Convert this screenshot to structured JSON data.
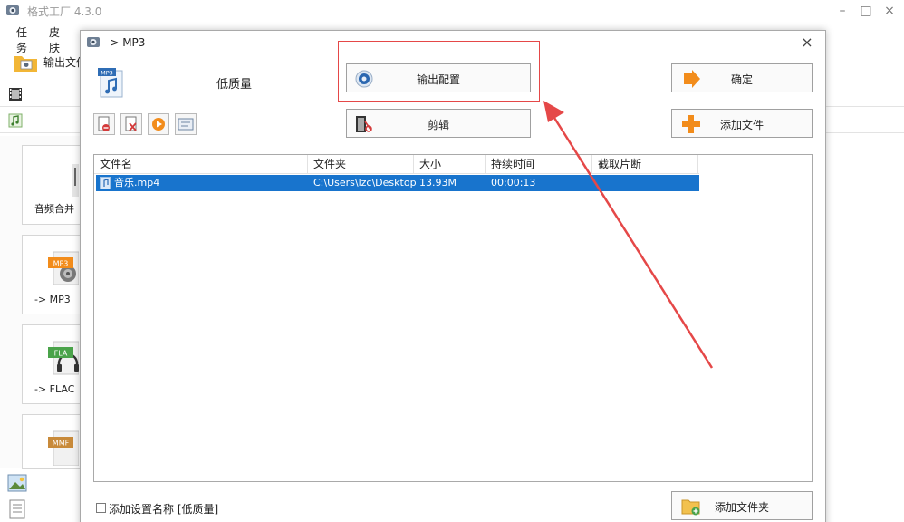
{
  "main_window": {
    "title": "格式工厂 4.3.0",
    "menu": [
      "任务",
      "皮肤"
    ],
    "toolbar": {
      "output_folder_label": "输出文件"
    },
    "tiles": [
      {
        "label": "音频合并"
      },
      {
        "label": "-> MP3",
        "badge": "MP3"
      },
      {
        "label": "-> FLAC",
        "badge": "FLA"
      },
      {
        "badge": "MMF"
      }
    ],
    "controls": {
      "minimize": "–",
      "maximize": "□",
      "close": "×"
    }
  },
  "dialog": {
    "title": "-> MP3",
    "close": "×",
    "profile_badge": "MP3",
    "quality": "低质量",
    "buttons": {
      "output_config": "输出配置",
      "ok": "确定",
      "clip": "剪辑",
      "add_file": "添加文件",
      "add_folder": "添加文件夹"
    },
    "table": {
      "columns": [
        "文件名",
        "文件夹",
        "大小",
        "持续时间",
        "截取片断"
      ],
      "rows": [
        {
          "name": "音乐.mp4",
          "folder": "C:\\Users\\lzc\\Desktop",
          "size": "13.93M",
          "duration": "00:00:13",
          "clip": ""
        }
      ]
    },
    "add_setting_name": {
      "checked": false,
      "label": "添加设置名称 [低质量]"
    }
  },
  "colors": {
    "selection": "#1874cd",
    "annotation": "#e54848",
    "accent_orange": "#f28c1b"
  }
}
